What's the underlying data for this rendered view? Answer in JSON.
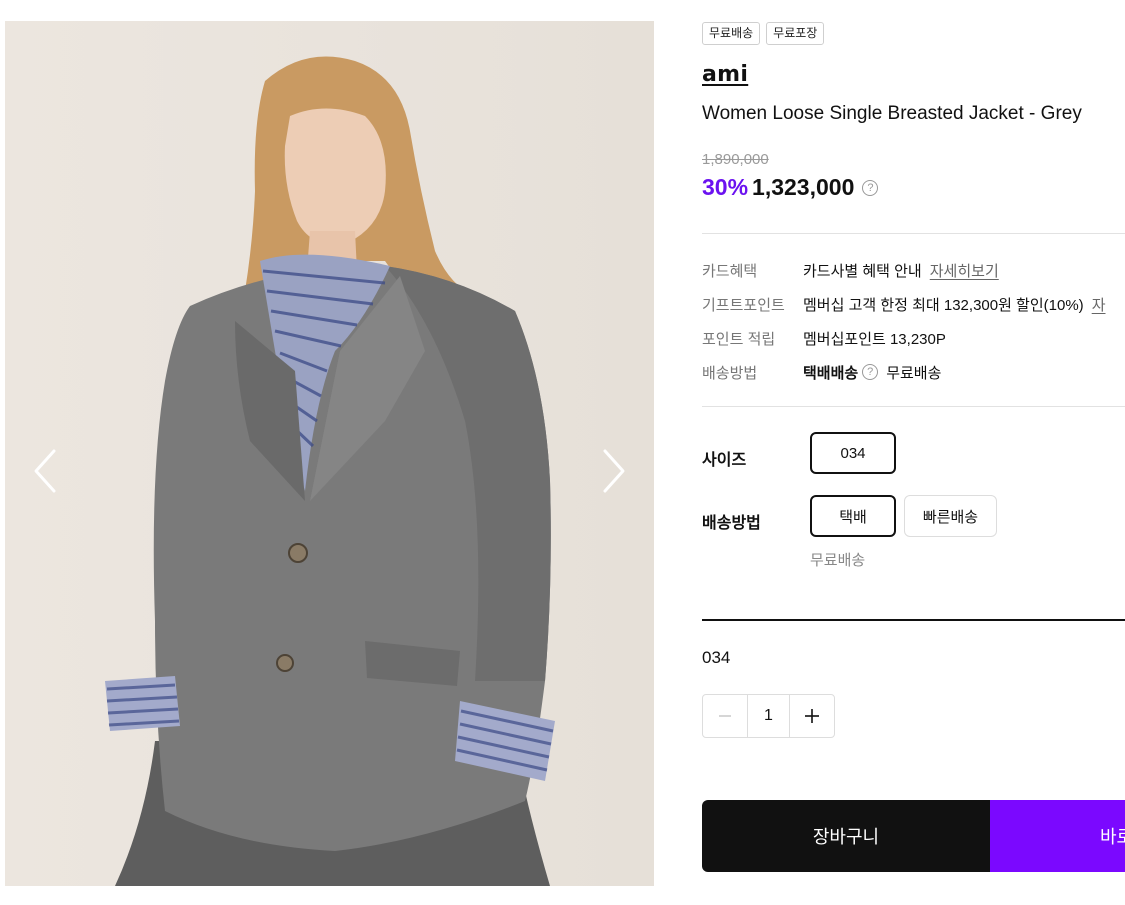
{
  "product": {
    "tags": [
      "무료배송",
      "무료포장"
    ],
    "brand": "ami",
    "name": "Women Loose Single Breasted Jacket - Grey",
    "original_price": "1,890,000",
    "discount": "30%",
    "sale_price": "1,323,000"
  },
  "benefits": {
    "card": {
      "label": "카드혜택",
      "value": "카드사별 혜택 안내",
      "link": "자세히보기"
    },
    "gift_point": {
      "label": "기프트포인트",
      "value": "멤버십 고객 한정 최대 132,300원 할인(10%)",
      "link": "자"
    },
    "point": {
      "label": "포인트 적립",
      "value": "멤버십포인트 13,230P"
    },
    "delivery": {
      "label": "배송방법",
      "method": "택배배송",
      "fee": "무료배송"
    }
  },
  "options": {
    "size_label": "사이즈",
    "size_value": "034",
    "delivery_label": "배송방법",
    "delivery_options": [
      "택배",
      "빠른배송"
    ],
    "delivery_note": "무료배송"
  },
  "selection": {
    "size": "034",
    "quantity": "1"
  },
  "actions": {
    "cart": "장바구니",
    "buy": "바로"
  },
  "colors": {
    "discount": "#6b12f0",
    "buy_button": "#7b08ff",
    "cart_button": "#111111"
  },
  "icons": [
    "chevron-left-icon",
    "chevron-right-icon",
    "question-icon",
    "minus-icon",
    "plus-icon"
  ]
}
